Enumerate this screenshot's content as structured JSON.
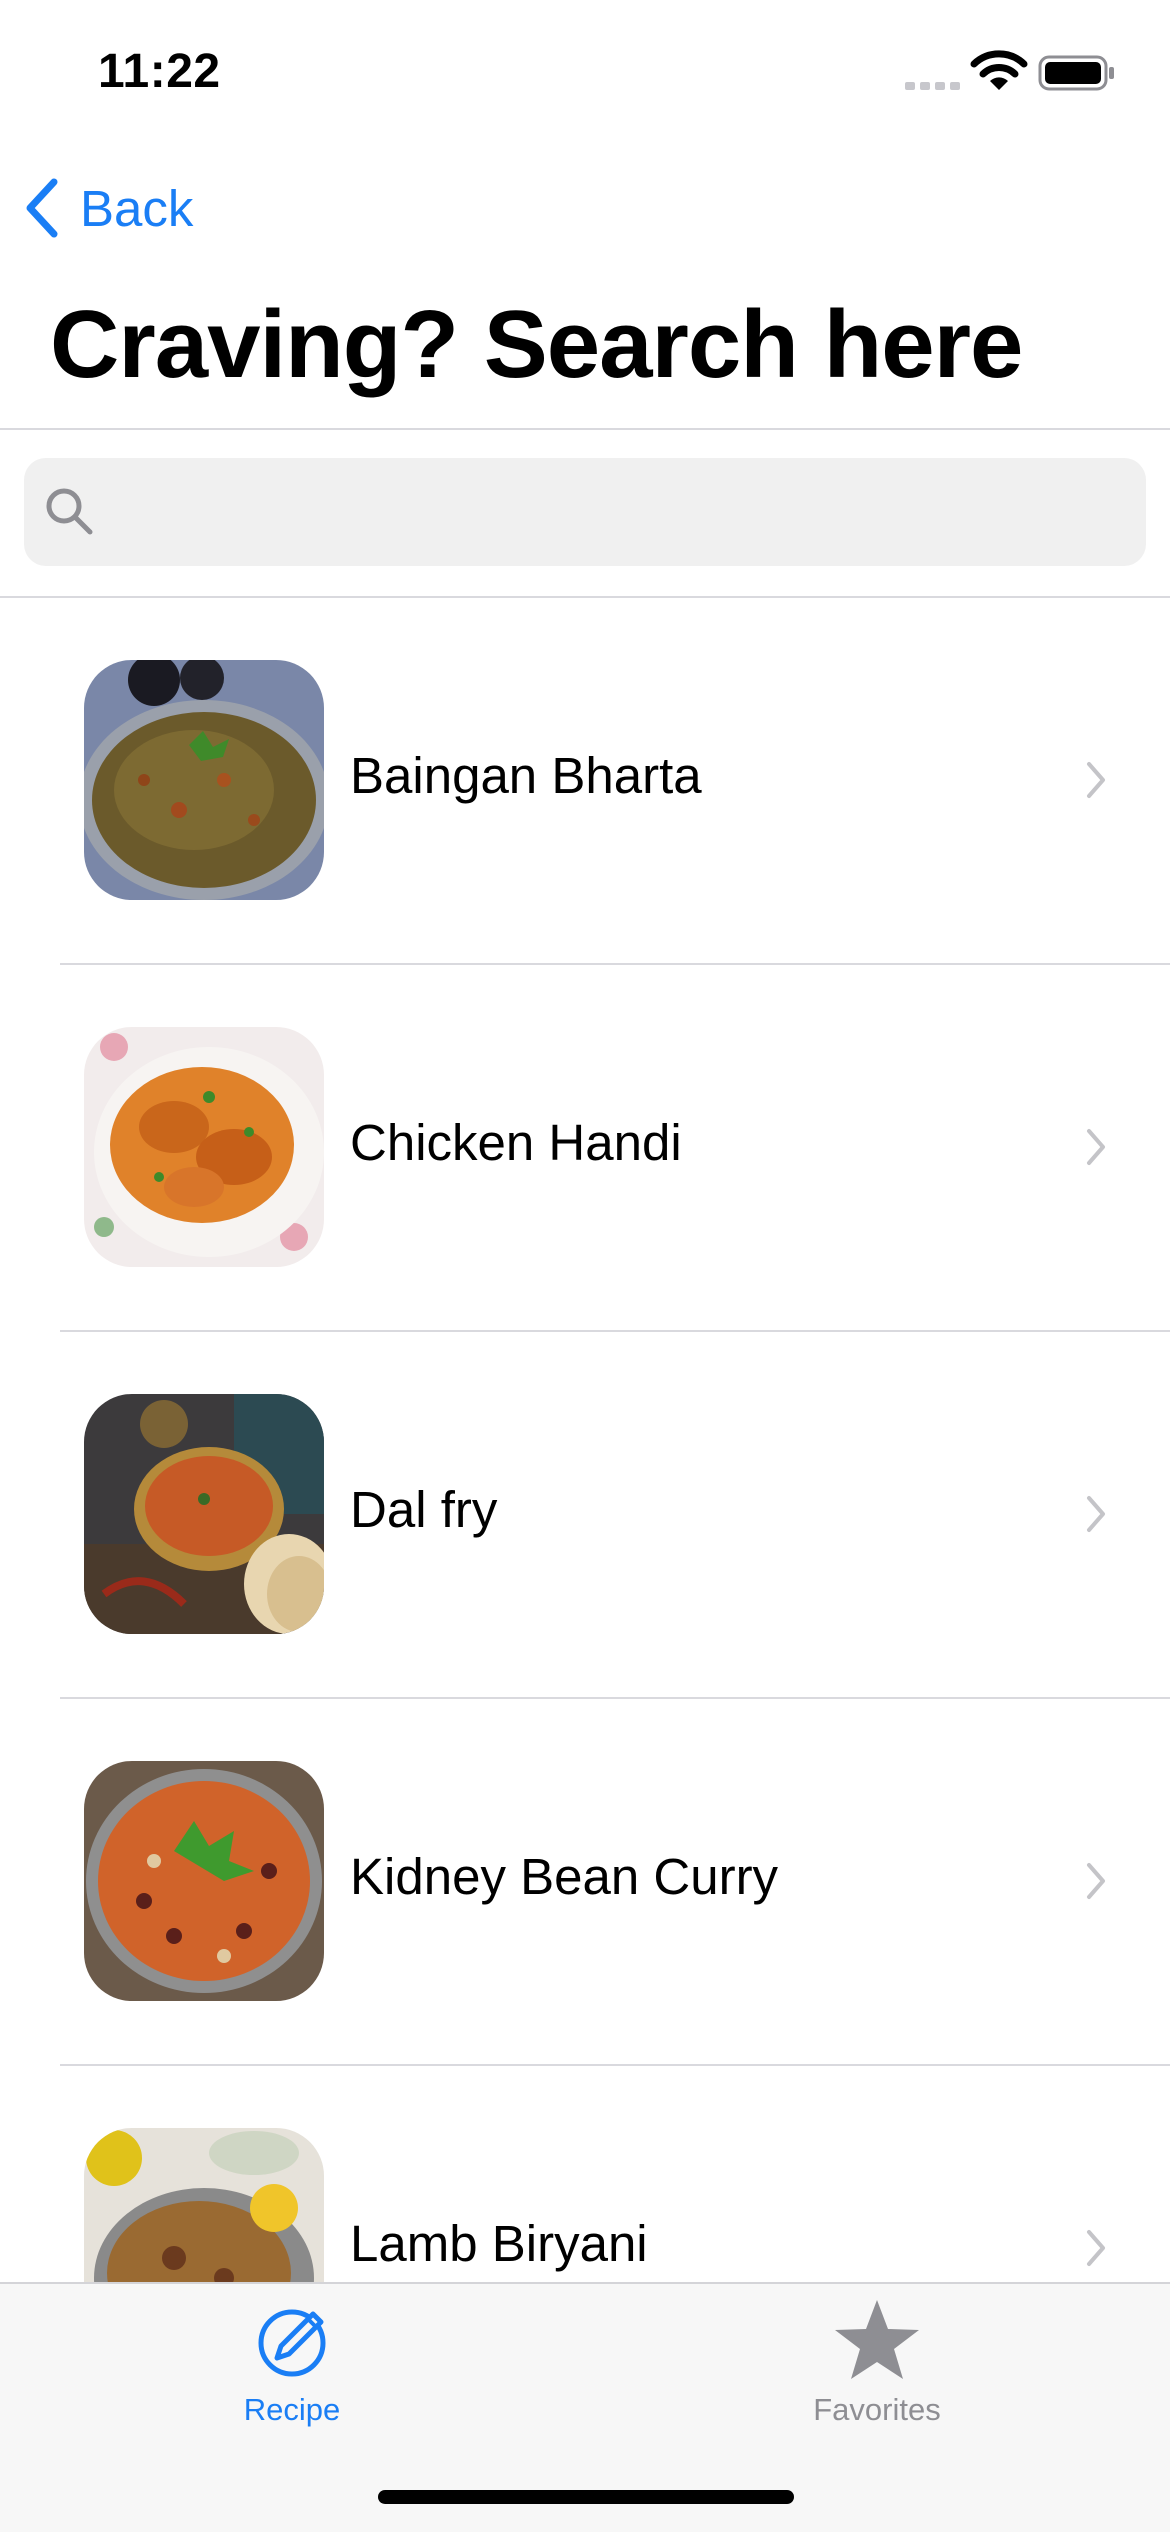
{
  "status_bar": {
    "time": "11:22"
  },
  "nav": {
    "back_label": "Back",
    "title": "Craving? Search here"
  },
  "search": {
    "placeholder": "",
    "value": ""
  },
  "recipes": [
    {
      "name": "Baingan Bharta"
    },
    {
      "name": "Chicken Handi"
    },
    {
      "name": "Dal fry"
    },
    {
      "name": "Kidney Bean Curry"
    },
    {
      "name": "Lamb Biryani"
    }
  ],
  "tabs": [
    {
      "label": "Recipe",
      "icon": "pencil-circle-icon",
      "active": true
    },
    {
      "label": "Favorites",
      "icon": "star-icon",
      "active": false
    }
  ],
  "colors": {
    "accent": "#1a7ef5",
    "inactive": "#8e8e93",
    "separator": "#d9d9de",
    "search_bg": "#f0f0f0",
    "tab_bar_bg": "#f7f7f7"
  }
}
